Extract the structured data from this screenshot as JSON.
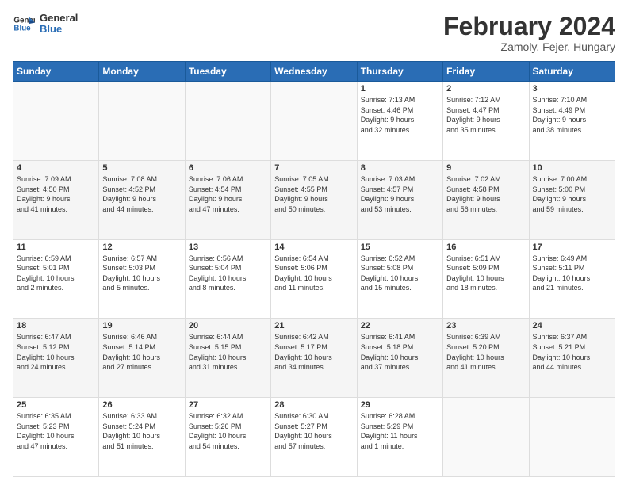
{
  "logo": {
    "line1": "General",
    "line2": "Blue"
  },
  "title": "February 2024",
  "location": "Zamoly, Fejer, Hungary",
  "days_of_week": [
    "Sunday",
    "Monday",
    "Tuesday",
    "Wednesday",
    "Thursday",
    "Friday",
    "Saturday"
  ],
  "weeks": [
    [
      {
        "day": "",
        "info": ""
      },
      {
        "day": "",
        "info": ""
      },
      {
        "day": "",
        "info": ""
      },
      {
        "day": "",
        "info": ""
      },
      {
        "day": "1",
        "info": "Sunrise: 7:13 AM\nSunset: 4:46 PM\nDaylight: 9 hours\nand 32 minutes."
      },
      {
        "day": "2",
        "info": "Sunrise: 7:12 AM\nSunset: 4:47 PM\nDaylight: 9 hours\nand 35 minutes."
      },
      {
        "day": "3",
        "info": "Sunrise: 7:10 AM\nSunset: 4:49 PM\nDaylight: 9 hours\nand 38 minutes."
      }
    ],
    [
      {
        "day": "4",
        "info": "Sunrise: 7:09 AM\nSunset: 4:50 PM\nDaylight: 9 hours\nand 41 minutes."
      },
      {
        "day": "5",
        "info": "Sunrise: 7:08 AM\nSunset: 4:52 PM\nDaylight: 9 hours\nand 44 minutes."
      },
      {
        "day": "6",
        "info": "Sunrise: 7:06 AM\nSunset: 4:54 PM\nDaylight: 9 hours\nand 47 minutes."
      },
      {
        "day": "7",
        "info": "Sunrise: 7:05 AM\nSunset: 4:55 PM\nDaylight: 9 hours\nand 50 minutes."
      },
      {
        "day": "8",
        "info": "Sunrise: 7:03 AM\nSunset: 4:57 PM\nDaylight: 9 hours\nand 53 minutes."
      },
      {
        "day": "9",
        "info": "Sunrise: 7:02 AM\nSunset: 4:58 PM\nDaylight: 9 hours\nand 56 minutes."
      },
      {
        "day": "10",
        "info": "Sunrise: 7:00 AM\nSunset: 5:00 PM\nDaylight: 9 hours\nand 59 minutes."
      }
    ],
    [
      {
        "day": "11",
        "info": "Sunrise: 6:59 AM\nSunset: 5:01 PM\nDaylight: 10 hours\nand 2 minutes."
      },
      {
        "day": "12",
        "info": "Sunrise: 6:57 AM\nSunset: 5:03 PM\nDaylight: 10 hours\nand 5 minutes."
      },
      {
        "day": "13",
        "info": "Sunrise: 6:56 AM\nSunset: 5:04 PM\nDaylight: 10 hours\nand 8 minutes."
      },
      {
        "day": "14",
        "info": "Sunrise: 6:54 AM\nSunset: 5:06 PM\nDaylight: 10 hours\nand 11 minutes."
      },
      {
        "day": "15",
        "info": "Sunrise: 6:52 AM\nSunset: 5:08 PM\nDaylight: 10 hours\nand 15 minutes."
      },
      {
        "day": "16",
        "info": "Sunrise: 6:51 AM\nSunset: 5:09 PM\nDaylight: 10 hours\nand 18 minutes."
      },
      {
        "day": "17",
        "info": "Sunrise: 6:49 AM\nSunset: 5:11 PM\nDaylight: 10 hours\nand 21 minutes."
      }
    ],
    [
      {
        "day": "18",
        "info": "Sunrise: 6:47 AM\nSunset: 5:12 PM\nDaylight: 10 hours\nand 24 minutes."
      },
      {
        "day": "19",
        "info": "Sunrise: 6:46 AM\nSunset: 5:14 PM\nDaylight: 10 hours\nand 27 minutes."
      },
      {
        "day": "20",
        "info": "Sunrise: 6:44 AM\nSunset: 5:15 PM\nDaylight: 10 hours\nand 31 minutes."
      },
      {
        "day": "21",
        "info": "Sunrise: 6:42 AM\nSunset: 5:17 PM\nDaylight: 10 hours\nand 34 minutes."
      },
      {
        "day": "22",
        "info": "Sunrise: 6:41 AM\nSunset: 5:18 PM\nDaylight: 10 hours\nand 37 minutes."
      },
      {
        "day": "23",
        "info": "Sunrise: 6:39 AM\nSunset: 5:20 PM\nDaylight: 10 hours\nand 41 minutes."
      },
      {
        "day": "24",
        "info": "Sunrise: 6:37 AM\nSunset: 5:21 PM\nDaylight: 10 hours\nand 44 minutes."
      }
    ],
    [
      {
        "day": "25",
        "info": "Sunrise: 6:35 AM\nSunset: 5:23 PM\nDaylight: 10 hours\nand 47 minutes."
      },
      {
        "day": "26",
        "info": "Sunrise: 6:33 AM\nSunset: 5:24 PM\nDaylight: 10 hours\nand 51 minutes."
      },
      {
        "day": "27",
        "info": "Sunrise: 6:32 AM\nSunset: 5:26 PM\nDaylight: 10 hours\nand 54 minutes."
      },
      {
        "day": "28",
        "info": "Sunrise: 6:30 AM\nSunset: 5:27 PM\nDaylight: 10 hours\nand 57 minutes."
      },
      {
        "day": "29",
        "info": "Sunrise: 6:28 AM\nSunset: 5:29 PM\nDaylight: 11 hours\nand 1 minute."
      },
      {
        "day": "",
        "info": ""
      },
      {
        "day": "",
        "info": ""
      }
    ]
  ]
}
